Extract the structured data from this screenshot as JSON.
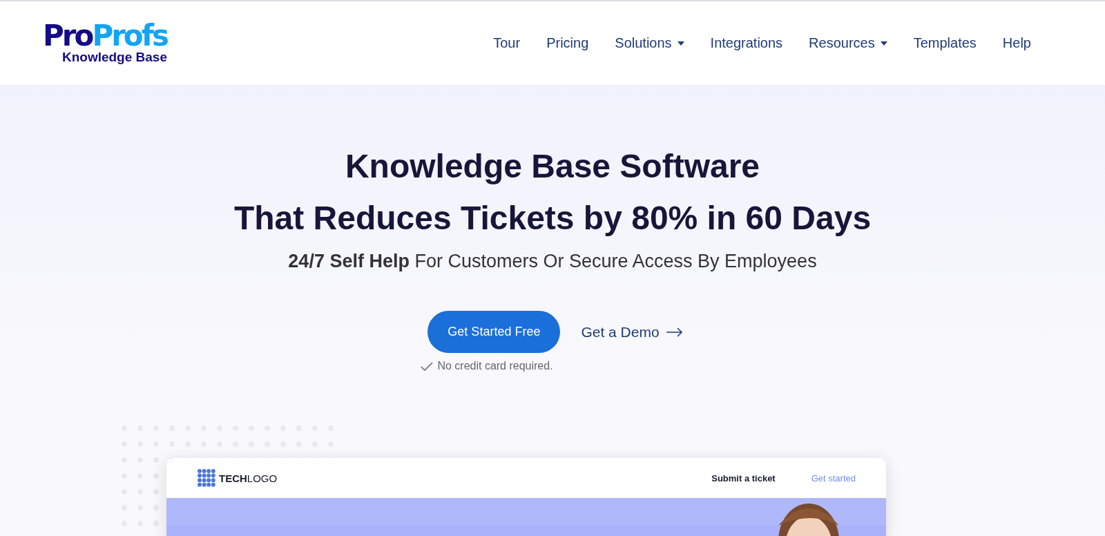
{
  "logo": {
    "brand_parts": [
      "Pro",
      "Profs"
    ],
    "product": "Knowledge Base"
  },
  "nav": [
    {
      "label": "Tour",
      "has_menu": false
    },
    {
      "label": "Pricing",
      "has_menu": false
    },
    {
      "label": "Solutions",
      "has_menu": true
    },
    {
      "label": "Integrations",
      "has_menu": false
    },
    {
      "label": "Resources",
      "has_menu": true
    },
    {
      "label": "Templates",
      "has_menu": false
    },
    {
      "label": "Help",
      "has_menu": false
    }
  ],
  "hero": {
    "title_lines": [
      "Knowledge Base Software",
      "That Reduces Tickets by 80% in 60 Days"
    ],
    "subtitle": "**24/7 Self Help** For Customers Or Secure Access By Employees",
    "primary_button": "Get Started Free",
    "secondary_link": "Get a Demo",
    "note": "No credit card required."
  },
  "preview": {
    "logo": "**TECH**LOGO",
    "links": [
      "Submit a ticket",
      "Get started"
    ]
  }
}
